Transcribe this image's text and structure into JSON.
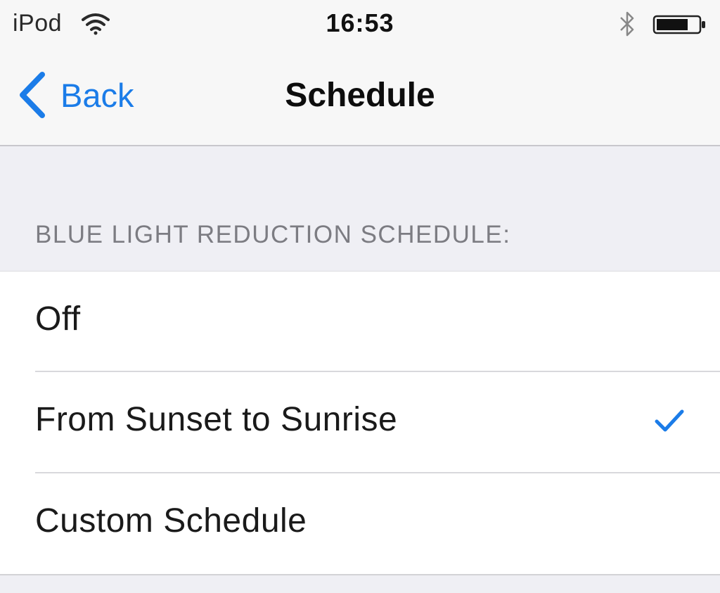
{
  "status_bar": {
    "carrier": "iPod",
    "time": "16:53",
    "icons": [
      "wifi-icon",
      "bluetooth-icon",
      "battery-icon"
    ]
  },
  "nav": {
    "back_label": "Back",
    "title": "Schedule"
  },
  "section": {
    "header": "BLUE LIGHT REDUCTION SCHEDULE:",
    "options": [
      {
        "label": "Off",
        "selected": false
      },
      {
        "label": "From Sunset to Sunrise",
        "selected": true
      },
      {
        "label": "Custom Schedule",
        "selected": false
      }
    ]
  },
  "colors": {
    "accent": "#1b7ce8",
    "background": "#efeff4",
    "bar": "#f7f7f7",
    "header_text": "#7c7c82"
  }
}
